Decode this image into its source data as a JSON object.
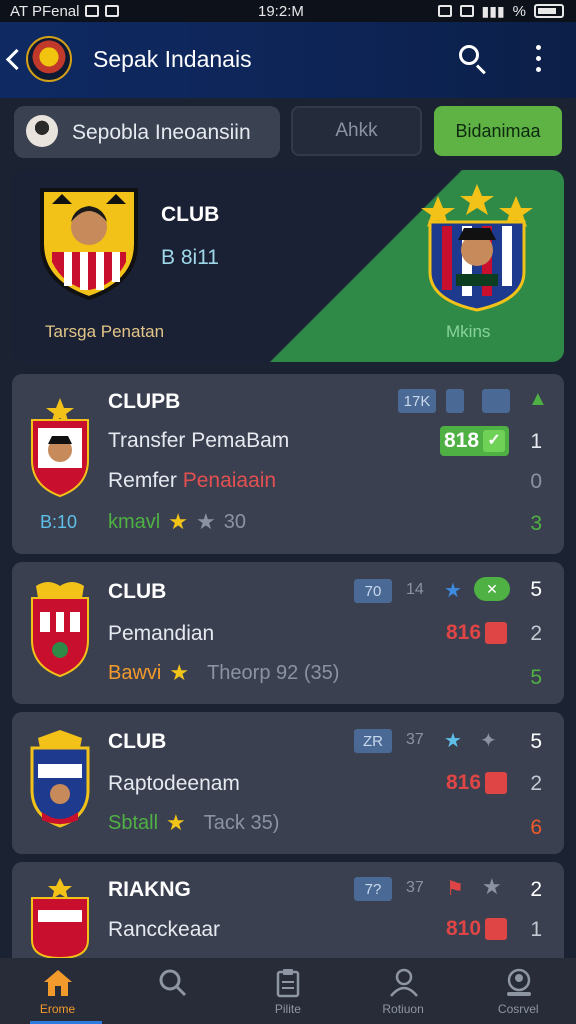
{
  "status_bar": {
    "carrier": "AT PFenal",
    "time": "19:2:M",
    "battery_label": "%"
  },
  "header": {
    "title": "Sepak Indanais",
    "logo_icon": "club-crest-icon",
    "back_icon": "chevron-left-icon",
    "search_icon": "search-icon",
    "more_icon": "more-vertical-icon"
  },
  "filter": {
    "profile_label": "Sepobla Ineoansiin",
    "button_secondary": "Ahkk",
    "button_primary": "Bidanimaa"
  },
  "hero": {
    "club_label": "CLUB",
    "score": "B 8i11",
    "caption_left": "Tarsga Penatan",
    "caption_right": "Mkins"
  },
  "cards": [
    {
      "title": "CLUPB",
      "tags": [
        "17K",
        "",
        ""
      ],
      "row1": "Transfer PemaBam",
      "row2_prefix": "Remfer",
      "row2_highlight": "Penaiaain",
      "row3_label": "kmavl",
      "row3_value": "30",
      "left_note": "B:10",
      "score": "818",
      "nums": [
        "1",
        "0",
        "3"
      ]
    },
    {
      "title": "CLUB",
      "tags": [
        "70",
        "14"
      ],
      "row1": "Pemandian",
      "row3_label": "Bawvi",
      "row3_value": "Theorp 92 (35)",
      "score": "816",
      "nums": [
        "5",
        "2",
        "5"
      ]
    },
    {
      "title": "CLUB",
      "tags": [
        "ZR",
        "37"
      ],
      "row1": "Raptodeenam",
      "row3_label": "Sbtall",
      "row3_value": "Tack 35)",
      "score": "816",
      "nums": [
        "5",
        "2",
        "6"
      ]
    },
    {
      "title": "RIAKNG",
      "tags": [
        "7?",
        "37"
      ],
      "row1": "Rancckeaar",
      "score": "810",
      "nums": [
        "2",
        "1"
      ]
    }
  ],
  "bottom_nav": [
    {
      "label": "Erome",
      "icon": "home-icon"
    },
    {
      "label": "",
      "icon": "search-icon"
    },
    {
      "label": "Pilite",
      "icon": "clipboard-icon"
    },
    {
      "label": "Rotiuon",
      "icon": "user-icon"
    },
    {
      "label": "Cosrvel",
      "icon": "profile-icon"
    }
  ],
  "colors": {
    "background": "#1b2232",
    "header": "#0f2a63",
    "card": "#3a4050",
    "accent_green": "#5fb345",
    "accent_orange": "#f39a2c",
    "score_red": "#e04545",
    "score_green": "#4fb043"
  }
}
